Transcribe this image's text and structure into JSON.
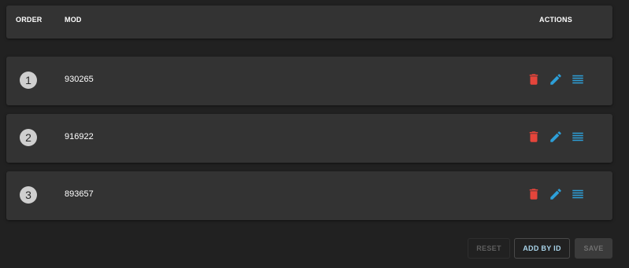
{
  "header": {
    "order_label": "ORDER",
    "mod_label": "MOD",
    "actions_label": "ACTIONS"
  },
  "rows": [
    {
      "order": "1",
      "mod": "930265"
    },
    {
      "order": "2",
      "mod": "916922"
    },
    {
      "order": "3",
      "mod": "893657"
    }
  ],
  "actions": {
    "delete_icon": "trash-icon",
    "edit_icon": "pencil-icon",
    "reorder_icon": "list-icon",
    "delete_color": "#e5453b",
    "edit_color": "#2d9fd8",
    "reorder_color": "#2d9fd8"
  },
  "footer": {
    "reset_label": "RESET",
    "add_label": "ADD BY ID",
    "save_label": "SAVE"
  }
}
